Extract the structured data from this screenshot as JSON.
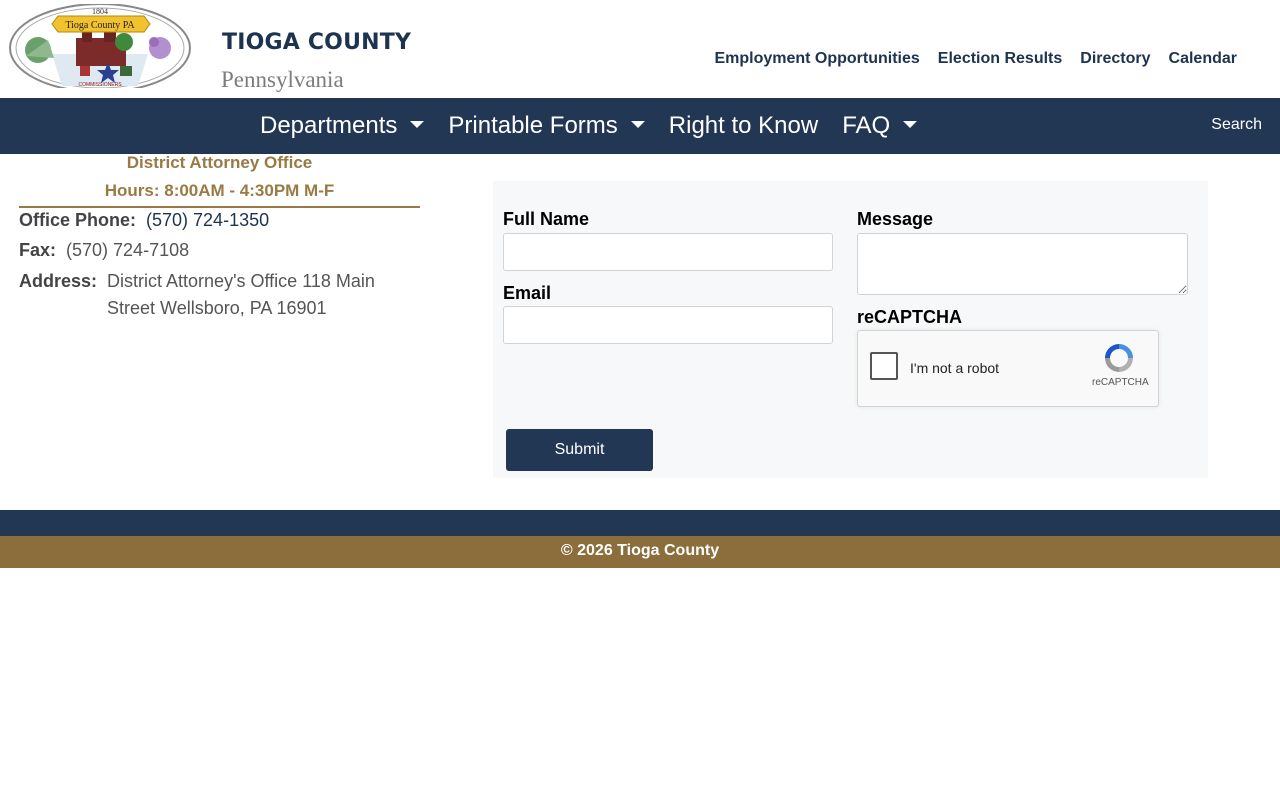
{
  "header": {
    "seal": {
      "year": "1804",
      "banner": "Tioga County PA",
      "ribbon": "COMMISSIONERS"
    },
    "title": "TIOGA COUNTY",
    "subtitle": "Pennsylvania",
    "links": [
      {
        "label": "Employment Opportunities"
      },
      {
        "label": "Election Results"
      },
      {
        "label": "Directory"
      },
      {
        "label": "Calendar"
      }
    ]
  },
  "nav": {
    "items": [
      {
        "label": "Departments",
        "dropdown": true
      },
      {
        "label": "Printable Forms",
        "dropdown": true
      },
      {
        "label": "Right to Know",
        "dropdown": false
      },
      {
        "label": "FAQ",
        "dropdown": true
      }
    ],
    "search_label": "Search"
  },
  "office": {
    "title": "District Attorney Office",
    "hours": "Hours: 8:00AM - 4:30PM M-F",
    "phone_label": "Office Phone:",
    "phone": "(570) 724-1350",
    "fax_label": "Fax:",
    "fax": "(570) 724-7108",
    "address_label": "Address:",
    "address": "District Attorney's Office 118 Main Street Wellsboro, PA 16901"
  },
  "form": {
    "full_name_label": "Full Name",
    "email_label": "Email",
    "message_label": "Message",
    "recaptcha_label": "reCAPTCHA",
    "captcha_text": "I'm not a robot",
    "captcha_brand": "reCAPTCHA",
    "submit_label": "Submit",
    "full_name_value": "",
    "email_value": "",
    "message_value": ""
  },
  "footer": {
    "copyright": "© 2026 Tioga County"
  },
  "colors": {
    "navy": "#213754",
    "gold": "#8b6e3c",
    "gold_text": "#9a7a44"
  }
}
